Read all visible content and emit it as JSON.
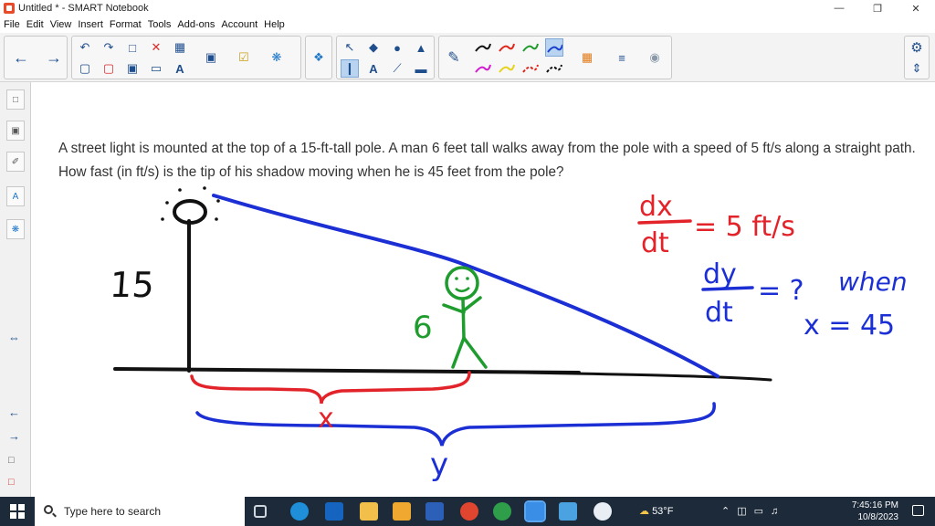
{
  "window": {
    "title": "Untitled * - SMART Notebook",
    "minimize": "—",
    "restore": "❐",
    "close": "✕"
  },
  "menu": [
    "File",
    "Edit",
    "View",
    "Insert",
    "Format",
    "Tools",
    "Add-ons",
    "Account",
    "Help"
  ],
  "toolbar": {
    "group1_icons": [
      "back-icon",
      "forward-icon"
    ],
    "group2_icons": [
      "undo-icon",
      "redo-icon",
      "new-page-icon",
      "delete-icon",
      "table-icon",
      "screen-shade-icon",
      "document-camera-icon",
      "lesson-activity-icon",
      "addons-icon"
    ],
    "group3_icons": [
      "select-icon",
      "shapes-icon",
      "fill-icon",
      "text-icon",
      "line-icon",
      "eraser-icon"
    ],
    "pen_colors": [
      "#111111",
      "#e0261a",
      "#1f9a2d",
      "#1a3fd0",
      "#d21ad2",
      "#e6d21a",
      "#e0261a",
      "#111111"
    ],
    "settings_icon": "gear-icon"
  },
  "sidebar": {
    "buttons": [
      "page-sorter-icon",
      "gallery-icon",
      "attachments-icon",
      "properties-icon",
      "addons-tab-icon"
    ],
    "move_icon": "⇔"
  },
  "canvas": {
    "problem_text": "A street light is mounted at the top of a 15-ft-tall pole. A man 6 feet tall walks away from the pole with a speed of 5 ft/s along a straight path. How fast (in ft/s) is the tip of his shadow moving when he is 45 feet from the pole?",
    "label_15": "15",
    "label_6": "6",
    "label_x": "x",
    "label_y": "y",
    "rate_dx": "dx",
    "rate_dt": "dt",
    "rate_value": "= 5 ft/s",
    "rate_dy": "dy",
    "rate_dt2": "dt",
    "rate_unknown": "= ?",
    "when_text": "when",
    "condition": "x = 45",
    "colors": {
      "red": "#e3232a",
      "blue": "#1b2fd4",
      "green": "#1e9c2e",
      "black": "#111111"
    }
  },
  "taskbar": {
    "search_placeholder": "Type here to search",
    "weather": "53°F",
    "time": "7:45:16 PM",
    "date": "10/8/2023"
  }
}
